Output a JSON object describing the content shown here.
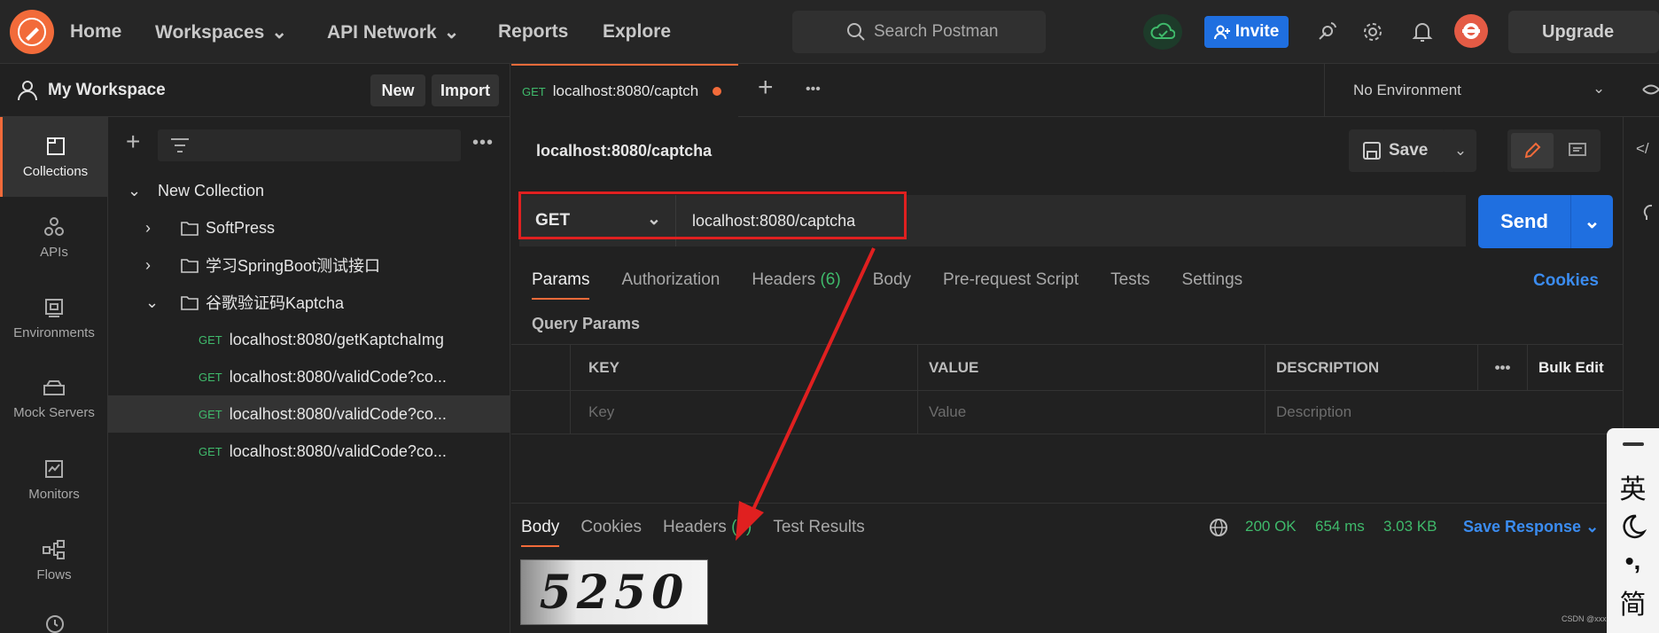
{
  "nav": {
    "home": "Home",
    "workspaces": "Workspaces",
    "api_network": "API Network",
    "reports": "Reports",
    "explore": "Explore",
    "search_placeholder": "Search Postman",
    "invite": "Invite",
    "upgrade": "Upgrade"
  },
  "workspace": {
    "title": "My Workspace",
    "new_label": "New",
    "import_label": "Import"
  },
  "rail": [
    {
      "label": "Collections",
      "icon": "collections-icon"
    },
    {
      "label": "APIs",
      "icon": "apis-icon"
    },
    {
      "label": "Environments",
      "icon": "environments-icon"
    },
    {
      "label": "Mock Servers",
      "icon": "mock-servers-icon"
    },
    {
      "label": "Monitors",
      "icon": "monitors-icon"
    },
    {
      "label": "Flows",
      "icon": "flows-icon"
    }
  ],
  "tree": {
    "collection": "New Collection",
    "folders": [
      "SoftPress",
      "学习SpringBoot测试接口",
      "谷歌验证码Kaptcha"
    ],
    "requests": [
      {
        "method": "GET",
        "name": "localhost:8080/getKaptchaImg"
      },
      {
        "method": "GET",
        "name": "localhost:8080/validCode?co..."
      },
      {
        "method": "GET",
        "name": "localhost:8080/validCode?co..."
      },
      {
        "method": "GET",
        "name": "localhost:8080/validCode?co..."
      }
    ]
  },
  "tab": {
    "method": "GET",
    "title": "localhost:8080/captch"
  },
  "environment": "No Environment",
  "request": {
    "name": "localhost:8080/captcha",
    "save_label": "Save",
    "method": "GET",
    "url": "localhost:8080/captcha",
    "send_label": "Send",
    "tabs": [
      "Params",
      "Authorization",
      "Headers",
      "Body",
      "Pre-request Script",
      "Tests",
      "Settings"
    ],
    "headers_count": "(6)",
    "cookies_label": "Cookies",
    "query_params_label": "Query Params",
    "columns": [
      "KEY",
      "VALUE",
      "DESCRIPTION"
    ],
    "bulk_edit": "Bulk Edit",
    "placeholders": {
      "key": "Key",
      "value": "Value",
      "description": "Description"
    }
  },
  "response": {
    "tabs": [
      "Body",
      "Cookies",
      "Headers",
      "Test Results"
    ],
    "headers_count": "(4)",
    "status": "200 OK",
    "time": "654 ms",
    "size": "3.03 KB",
    "save_label": "Save Response",
    "captcha_text": "5250"
  },
  "ime": {
    "lang": "英",
    "mode": "简"
  },
  "watermark": "CSDN @xxx",
  "colors": {
    "accent": "#f26b3a",
    "primary": "#1f6fe0",
    "success": "#3fba6b",
    "annotation": "#e02020"
  }
}
